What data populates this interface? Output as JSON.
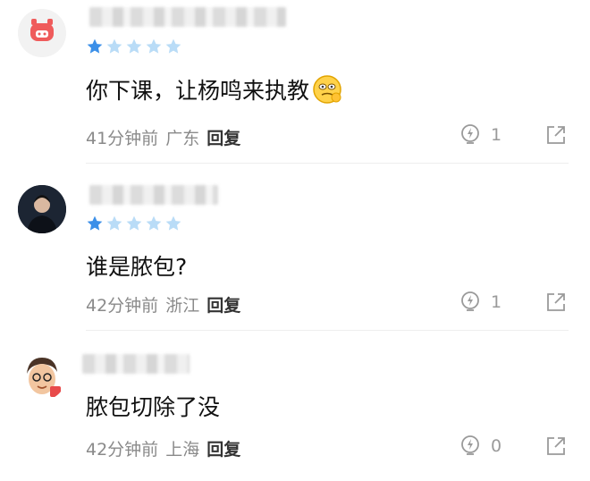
{
  "comments": [
    {
      "avatar_icon": "pig-icon",
      "rating": 1,
      "text": "你下课，让杨鸣来执教",
      "emoji_icon": "thinking-emoji-icon",
      "time": "41分钟前",
      "location": "广东",
      "reply_label": "回复",
      "likes": "1"
    },
    {
      "avatar_icon": "person-photo-icon",
      "rating": 1,
      "text": "谁是脓包?",
      "time": "42分钟前",
      "location": "浙江",
      "reply_label": "回复",
      "likes": "1"
    },
    {
      "avatar_icon": "cartoon-face-icon",
      "text": "脓包切除了没",
      "time": "42分钟前",
      "location": "上海",
      "reply_label": "回复",
      "likes": "0"
    }
  ],
  "colors": {
    "star_active": "#3b8fe8",
    "star_inactive": "#b9dcf7",
    "meta": "#8a8a8a"
  }
}
